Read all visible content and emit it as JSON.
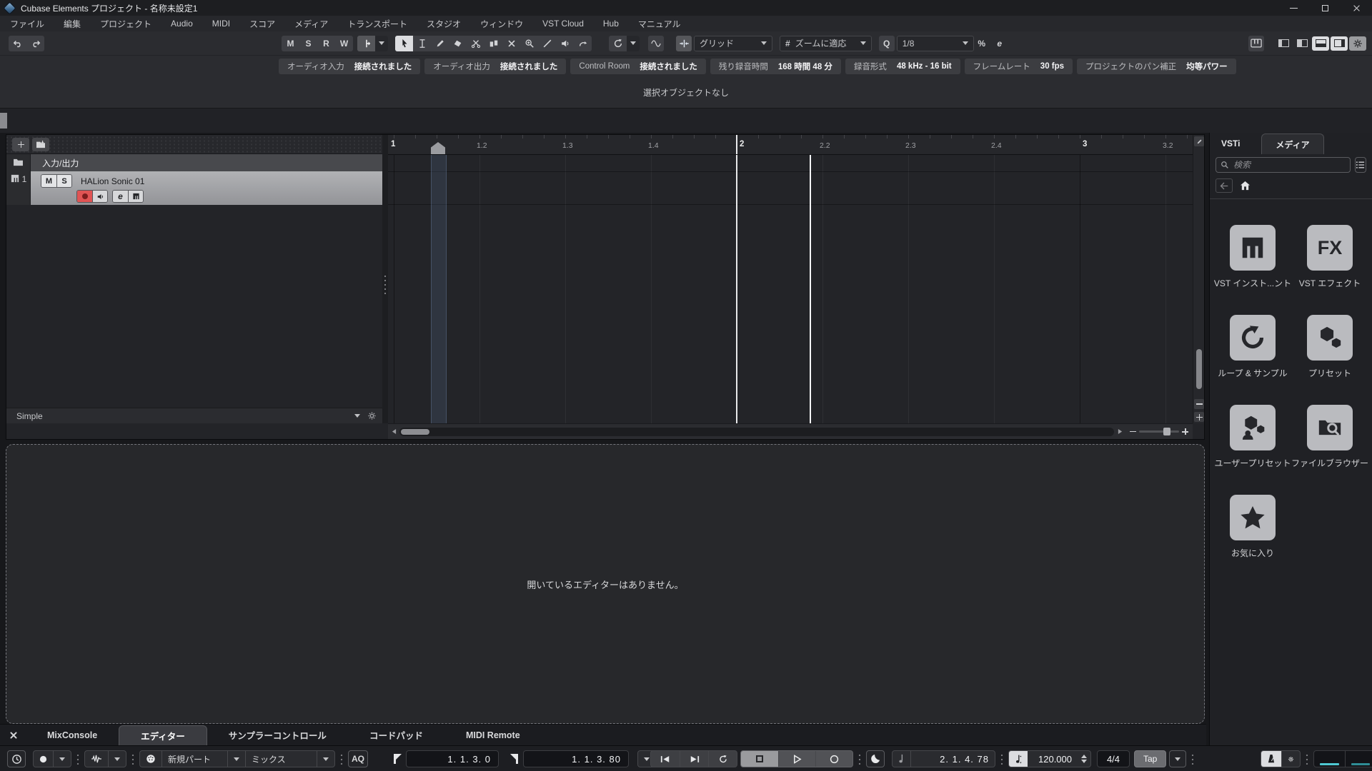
{
  "titlebar": {
    "title": "Cubase Elements プロジェクト - 名称未設定1"
  },
  "menu": {
    "items": [
      "ファイル",
      "編集",
      "プロジェクト",
      "Audio",
      "MIDI",
      "スコア",
      "メディア",
      "トランスポート",
      "スタジオ",
      "ウィンドウ",
      "VST Cloud",
      "Hub",
      "マニュアル"
    ]
  },
  "toolbar": {
    "msrw": [
      "M",
      "S",
      "R",
      "W"
    ],
    "grid_label": "グリッド",
    "zoom_fit_label": "ズームに適応",
    "q_label": "Q",
    "quantize_value": "1/8",
    "hash_label": "#",
    "iq_label": "%",
    "open_q_label": "e"
  },
  "infoline": {
    "items": [
      {
        "label": "オーディオ入力",
        "value": "接続されました"
      },
      {
        "label": "オーディオ出力",
        "value": "接続されました"
      },
      {
        "label": "Control Room",
        "value": "接続されました"
      },
      {
        "label": "残り録音時間",
        "value": "168 時間 48 分"
      },
      {
        "label": "録音形式",
        "value": "48 kHz - 16 bit"
      },
      {
        "label": "フレームレート",
        "value": "30 fps"
      },
      {
        "label": "プロジェクトのパン補正",
        "value": "均等パワー"
      }
    ]
  },
  "status": {
    "text": "選択オブジェクトなし"
  },
  "project": {
    "folder_label": "入力/出力",
    "track_number": "1",
    "track_name": "HALion Sonic 01",
    "mute_label": "M",
    "solo_label": "S",
    "edit_label": "e",
    "view_preset": "Simple"
  },
  "ruler": {
    "ticks": [
      "1",
      "1.2",
      "1.3",
      "1.4",
      "2",
      "2.2",
      "2.3",
      "2.4",
      "3",
      "3.2"
    ]
  },
  "lower_zone": {
    "message": "開いているエディターはありません。"
  },
  "bottom_tabs": {
    "items": [
      "MixConsole",
      "エディター",
      "サンプラーコントロール",
      "コードパッド",
      "MIDI Remote"
    ]
  },
  "right_zone": {
    "tabs": [
      "VSTi",
      "メディア"
    ],
    "search_placeholder": "検索",
    "tiles": [
      {
        "label": "VST インスト...ント"
      },
      {
        "label": "VST エフェクト",
        "glyph": "FX"
      },
      {
        "label": "ループ & サンプル"
      },
      {
        "label": "プリセット"
      },
      {
        "label": "ユーザープリセット"
      },
      {
        "label": "ファイルブラウザー"
      },
      {
        "label": "お気に入り"
      }
    ]
  },
  "transport": {
    "midi_record_mode": "新規パート",
    "midi_mix_mode": "ミックス",
    "aq_label": "AQ",
    "left_locator": "1. 1. 3. 0",
    "right_locator": "1. 1. 3. 80",
    "position": "2. 1. 4. 78",
    "tempo": "120.000",
    "time_signature": "4/4",
    "tap_label": "Tap"
  },
  "colors": {
    "record_red": "#e05454",
    "meter_cyan": "#4fc9d3",
    "selected_track": "#a3a4a8"
  }
}
